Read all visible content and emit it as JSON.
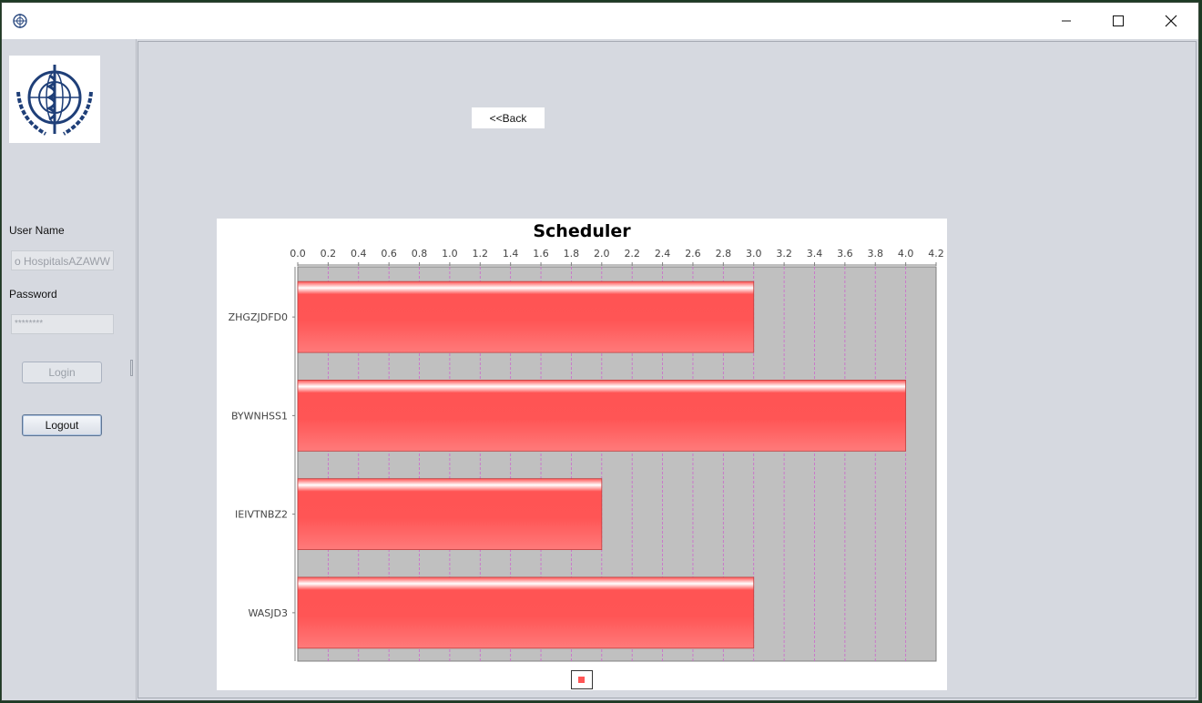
{
  "sidebar": {
    "username_label": "User Name",
    "username_value": "o HospitalsAZAWW",
    "password_label": "Password",
    "password_value": "********",
    "login_label": "Login",
    "logout_label": "Logout"
  },
  "main": {
    "back_label": "<<Back"
  },
  "colors": {
    "bar": "#ff5555",
    "plot_bg": "#c0c0c0",
    "grid": "#cc66cc"
  },
  "chart_data": {
    "type": "bar",
    "orientation": "horizontal",
    "title": "Scheduler",
    "categories": [
      "ZHGZJDFD0",
      "BYWNHSS1",
      "IEIVTNBZ2",
      "WASJD3"
    ],
    "values": [
      3,
      4,
      2,
      3
    ],
    "xlim": [
      0,
      4.2
    ],
    "ticks": [
      "0.0",
      "0.2",
      "0.4",
      "0.6",
      "0.8",
      "1.0",
      "1.2",
      "1.4",
      "1.6",
      "1.8",
      "2.0",
      "2.2",
      "2.4",
      "2.6",
      "2.8",
      "3.0",
      "3.2",
      "3.4",
      "3.6",
      "3.8",
      "4.0",
      "4.2"
    ],
    "grid": true,
    "legend": "bottom"
  }
}
